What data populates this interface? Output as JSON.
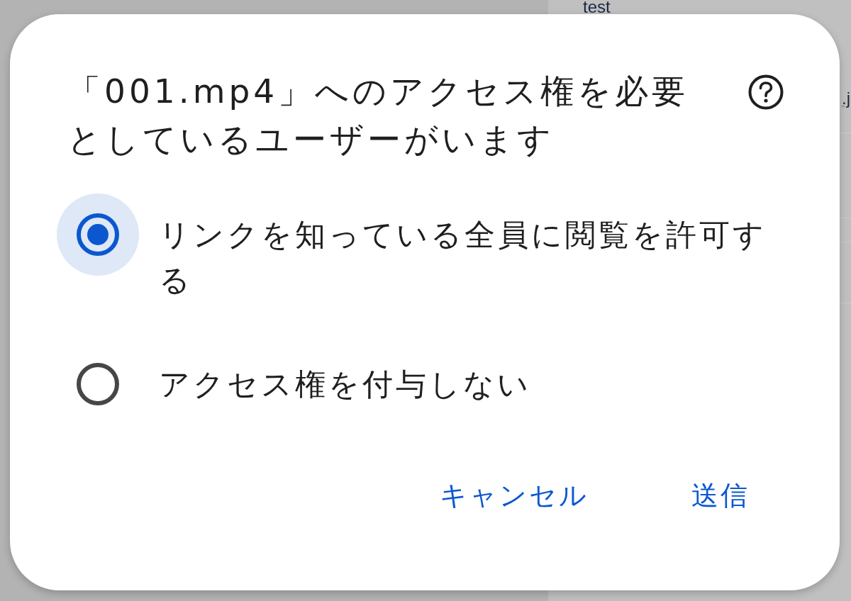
{
  "background": {
    "labels": [
      "test",
      ".j"
    ]
  },
  "dialog": {
    "title": "「001.mp4」へのアクセス権を必要としているユーザーがいます",
    "options": [
      {
        "label": "リンクを知っている全員に閲覧を許可する",
        "selected": true
      },
      {
        "label": "アクセス権を付与しない",
        "selected": false
      }
    ],
    "buttons": [
      {
        "label": "キャンセル"
      },
      {
        "label": "送信"
      }
    ]
  }
}
